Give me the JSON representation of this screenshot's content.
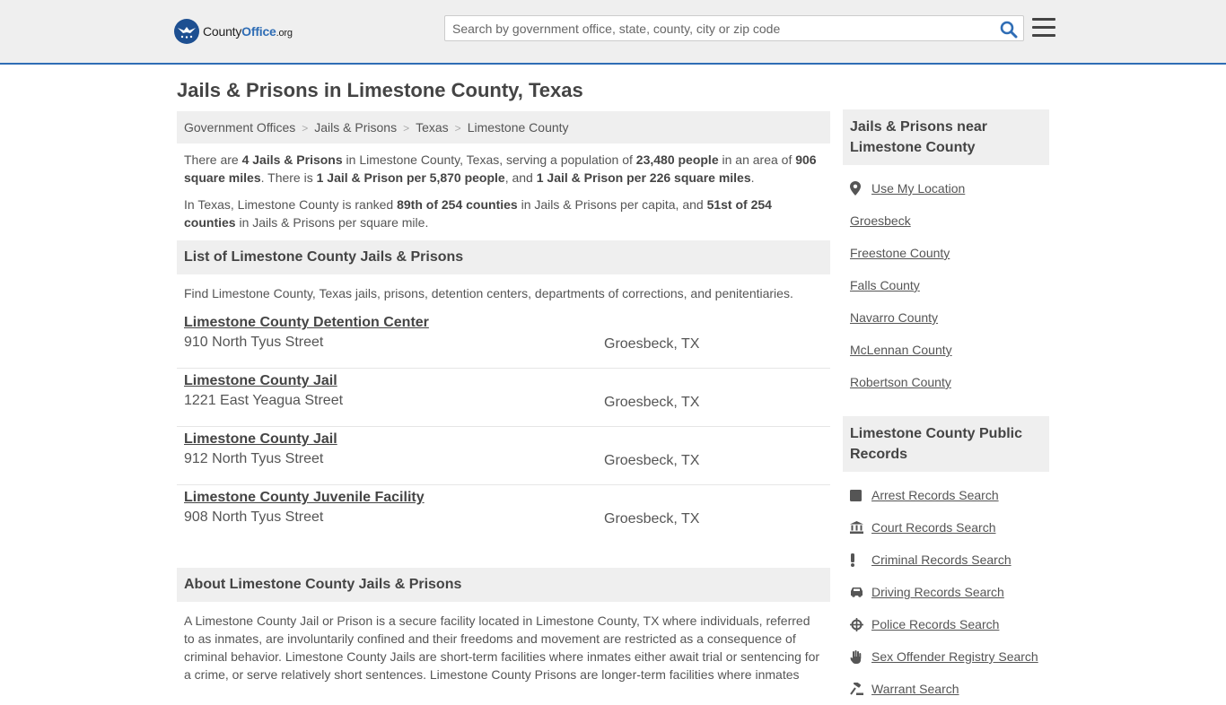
{
  "header": {
    "logo_county": "County",
    "logo_office": "Office",
    "logo_tld": ".org",
    "search_placeholder": "Search by government office, state, county, city or zip code"
  },
  "page_title": "Jails & Prisons in Limestone County, Texas",
  "breadcrumb": [
    "Government Offices",
    "Jails & Prisons",
    "Texas",
    "Limestone County"
  ],
  "intro": {
    "p1": [
      {
        "t": "There are ",
        "b": false
      },
      {
        "t": "4 Jails & Prisons",
        "b": true
      },
      {
        "t": " in Limestone County, Texas, serving a population of ",
        "b": false
      },
      {
        "t": "23,480 people",
        "b": true
      },
      {
        "t": " in an area of ",
        "b": false
      },
      {
        "t": "906 square miles",
        "b": true
      },
      {
        "t": ". There is ",
        "b": false
      },
      {
        "t": "1 Jail & Prison per 5,870 people",
        "b": true
      },
      {
        "t": ", and ",
        "b": false
      },
      {
        "t": "1 Jail & Prison per 226 square miles",
        "b": true
      },
      {
        "t": ".",
        "b": false
      }
    ],
    "p2": [
      {
        "t": "In Texas, Limestone County is ranked ",
        "b": false
      },
      {
        "t": "89th of 254 counties",
        "b": true
      },
      {
        "t": " in Jails & Prisons per capita, and ",
        "b": false
      },
      {
        "t": "51st of 254 counties",
        "b": true
      },
      {
        "t": " in Jails & Prisons per square mile.",
        "b": false
      }
    ]
  },
  "list_section": {
    "title": "List of Limestone County Jails & Prisons",
    "description": "Find Limestone County, Texas jails, prisons, detention centers, departments of corrections, and penitentiaries.",
    "items": [
      {
        "name": "Limestone County Detention Center",
        "address": "910 North Tyus Street",
        "city": "Groesbeck, TX"
      },
      {
        "name": "Limestone County Jail",
        "address": "1221 East Yeagua Street",
        "city": "Groesbeck, TX"
      },
      {
        "name": "Limestone County Jail",
        "address": "912 North Tyus Street",
        "city": "Groesbeck, TX"
      },
      {
        "name": "Limestone County Juvenile Facility",
        "address": "908 North Tyus Street",
        "city": "Groesbeck, TX"
      }
    ]
  },
  "about_section": {
    "title": "About Limestone County Jails & Prisons",
    "text": "A Limestone County Jail or Prison is a secure facility located in Limestone County, TX where individuals, referred to as inmates, are involuntarily confined and their freedoms and movement are restricted as a consequence of criminal behavior. Limestone County Jails are short-term facilities where inmates either await trial or sentencing for a crime, or serve relatively short sentences. Limestone County Prisons are longer-term facilities where inmates"
  },
  "sidebar": {
    "nearby_title": "Jails & Prisons near Limestone County",
    "nearby_items": [
      {
        "label": "Use My Location",
        "icon": "map-pin-icon"
      },
      {
        "label": "Groesbeck"
      },
      {
        "label": "Freestone County"
      },
      {
        "label": "Falls County"
      },
      {
        "label": "Navarro County"
      },
      {
        "label": "McLennan County"
      },
      {
        "label": "Robertson County"
      }
    ],
    "records_title": "Limestone County Public Records",
    "records_items": [
      {
        "label": "Arrest Records Search",
        "icon": "square-icon"
      },
      {
        "label": "Court Records Search",
        "icon": "courthouse-icon"
      },
      {
        "label": "Criminal Records Search",
        "icon": "exclamation-icon"
      },
      {
        "label": "Driving Records Search",
        "icon": "car-icon"
      },
      {
        "label": "Police Records Search",
        "icon": "crosshair-icon"
      },
      {
        "label": "Sex Offender Registry Search",
        "icon": "hand-icon"
      },
      {
        "label": "Warrant Search",
        "icon": "gavel-icon"
      }
    ]
  }
}
